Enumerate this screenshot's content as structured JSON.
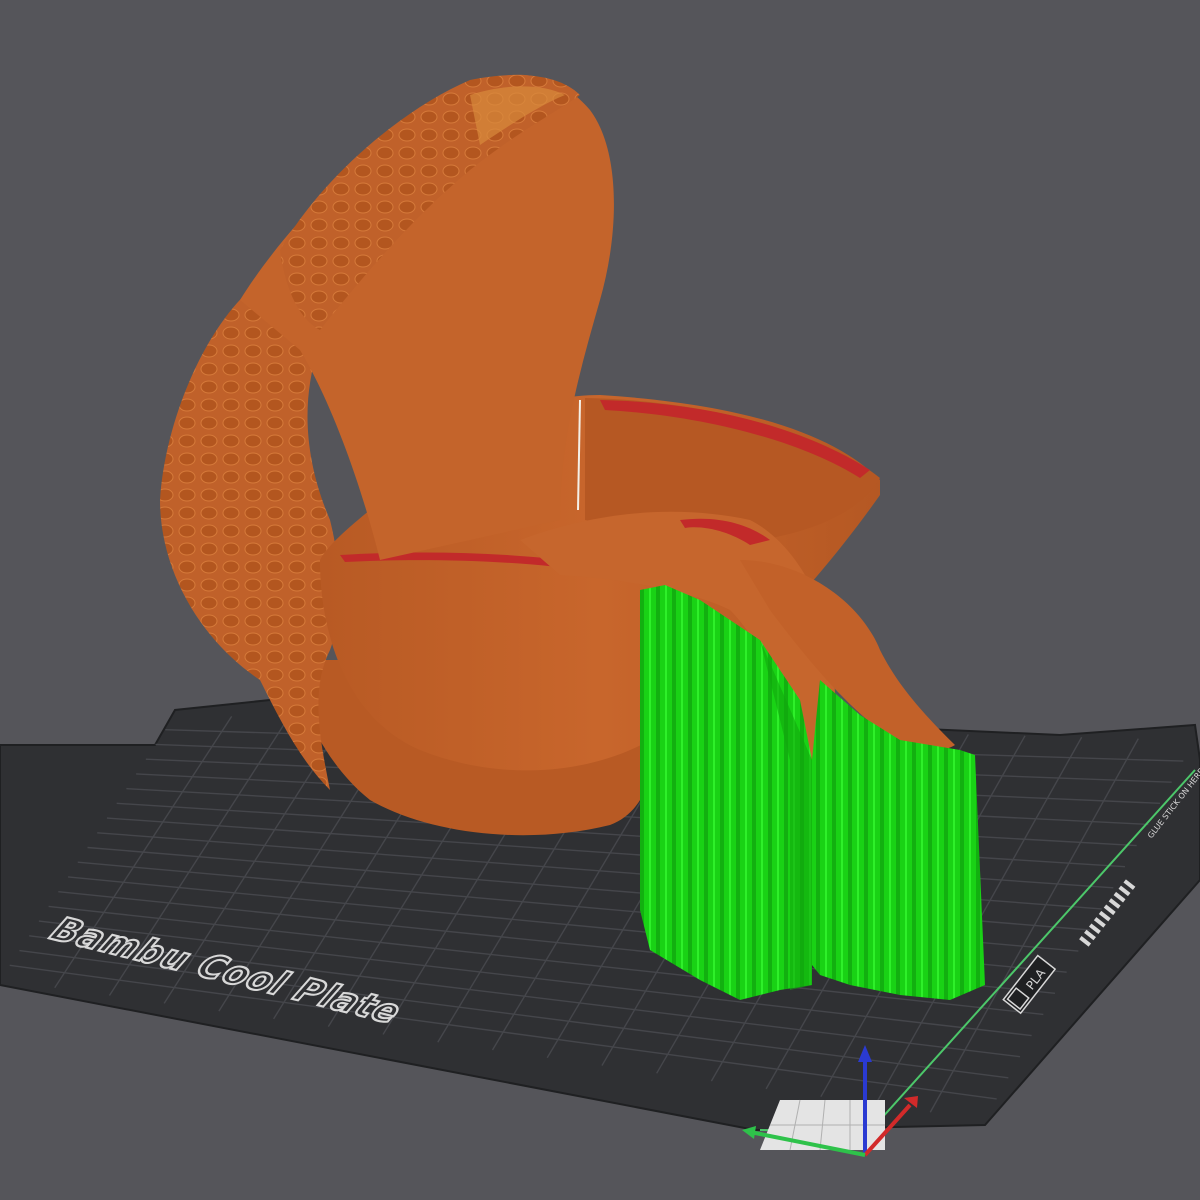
{
  "viewport": {
    "background_color": "#55555a"
  },
  "plate": {
    "label": "Bambu Cool Plate",
    "material_badge": "PLA",
    "notice_text": "GLUE STICK ON HERE",
    "surface_color": "#2f3033",
    "grid_color": "#45464b",
    "edge_color": "#4cc76a"
  },
  "model": {
    "body_color": "#c0612a",
    "support_color": "#19d215",
    "overhang_color": "#c22a2a"
  },
  "axes": {
    "x_color": "#d22a2a",
    "y_color": "#2ec24a",
    "z_color": "#2a3ad2"
  }
}
